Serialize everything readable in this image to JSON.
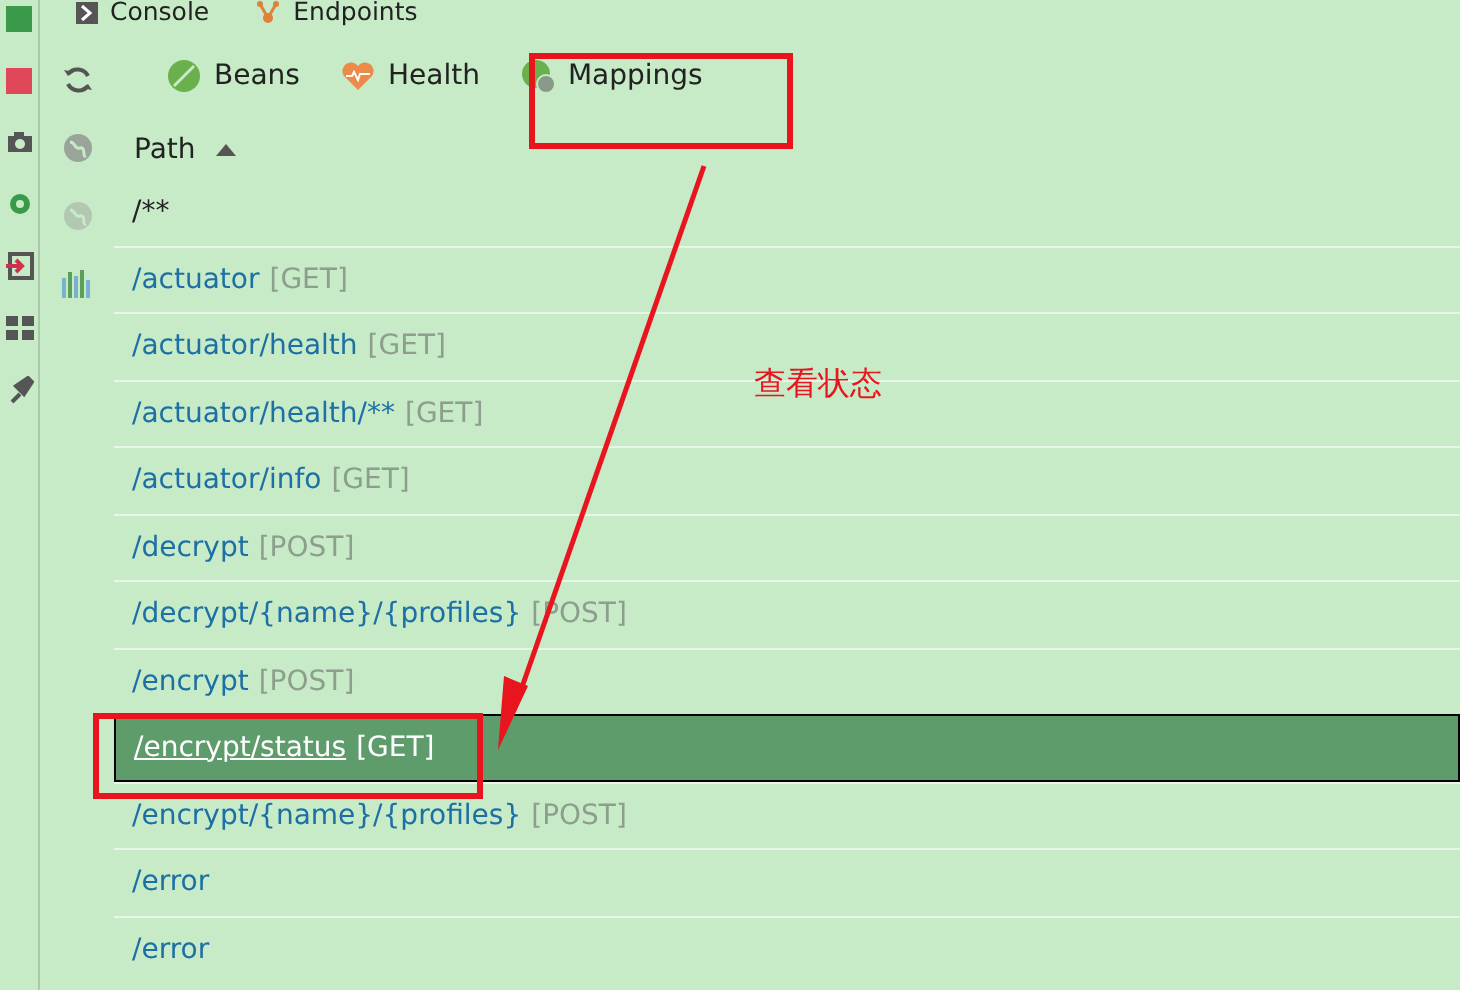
{
  "top_tabs": [
    {
      "label": "Console",
      "kind": "console"
    },
    {
      "label": "Endpoints",
      "kind": "endpoints"
    }
  ],
  "endpoint_tabs": [
    {
      "label": "Beans",
      "kind": "beans"
    },
    {
      "label": "Health",
      "kind": "health"
    },
    {
      "label": "Mappings",
      "kind": "mappings"
    }
  ],
  "table": {
    "columns": [
      {
        "label": "Path",
        "sort_ascending": true
      }
    ],
    "rows": [
      {
        "path": "/**",
        "selected": false
      },
      {
        "path": "/actuator",
        "method": "[GET]",
        "selected": false
      },
      {
        "path": "/actuator/health",
        "method": "[GET]",
        "selected": false
      },
      {
        "path": "/actuator/health/**",
        "method": "[GET]",
        "selected": false
      },
      {
        "path": "/actuator/info",
        "method": "[GET]",
        "selected": false
      },
      {
        "path": "/decrypt",
        "method": "[POST]",
        "selected": false
      },
      {
        "path": "/decrypt/{name}/{profiles}",
        "method": "[POST]",
        "selected": false
      },
      {
        "path": "/encrypt",
        "method": "[POST]",
        "selected": false
      },
      {
        "path": "/encrypt/status",
        "method": "[GET]",
        "selected": true
      },
      {
        "path": "/encrypt/{name}/{profiles}",
        "method": "[POST]",
        "selected": false
      },
      {
        "path": "/error",
        "selected": false
      },
      {
        "path": "/error",
        "selected": false
      }
    ]
  },
  "annotation": {
    "text": "查看状态"
  }
}
